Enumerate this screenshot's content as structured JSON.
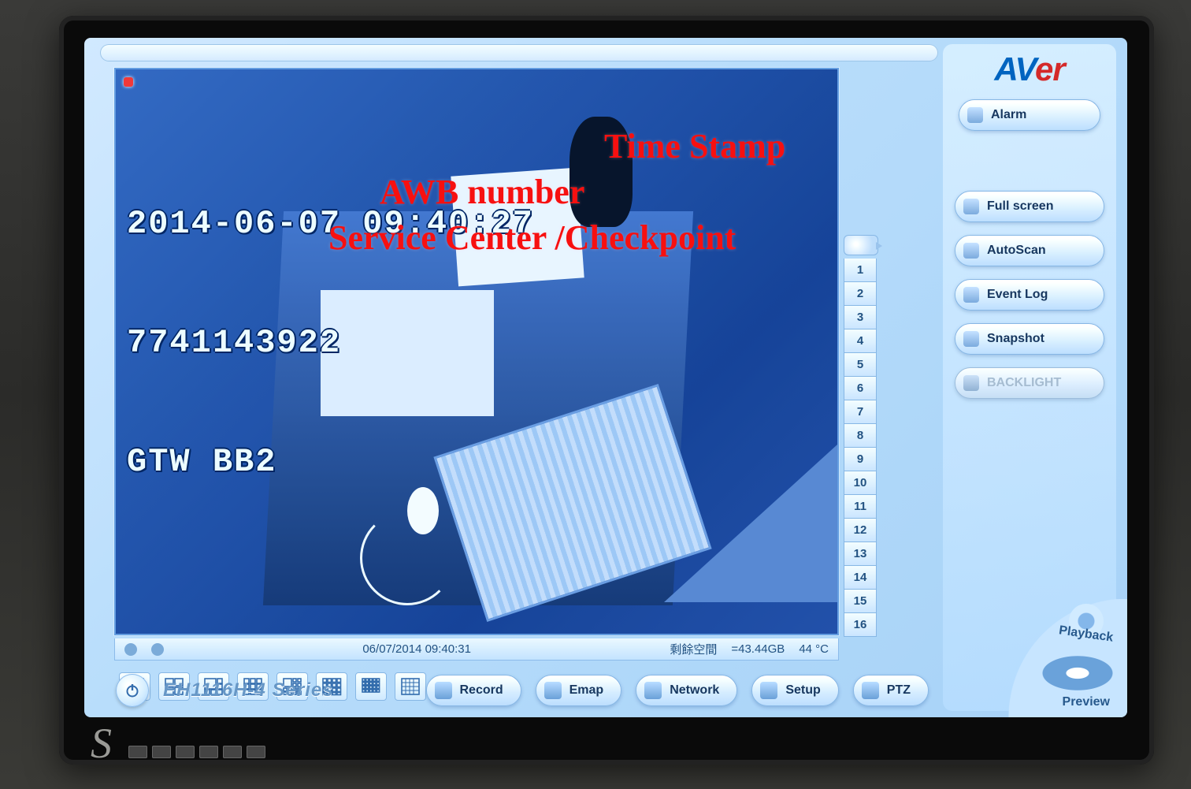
{
  "brand": {
    "logo_a": "AV",
    "logo_b": "er"
  },
  "video_osd": {
    "timestamp": "2014-06-07 09:40:27",
    "awb": "7741143922",
    "checkpoint": "GTW BB2"
  },
  "annotations": {
    "timestamp": "Time Stamp",
    "awb": "AWB number",
    "checkpoint": "Service Center /Checkpoint"
  },
  "statusbar": {
    "datetime": "06/07/2014 09:40:31",
    "disk_label": "剩餘空間",
    "disk_value": "=43.44GB",
    "temp": "44 °C"
  },
  "channels": [
    "1",
    "2",
    "3",
    "4",
    "5",
    "6",
    "7",
    "8",
    "9",
    "10",
    "11",
    "12",
    "13",
    "14",
    "15",
    "16"
  ],
  "sidebar": {
    "alarm": "Alarm",
    "fullscreen": "Full screen",
    "autoscan": "AutoScan",
    "eventlog": "Event Log",
    "snapshot": "Snapshot",
    "backlight": "BACKLIGHT"
  },
  "cmdbar": {
    "model": "EH1116H-4 Series",
    "record": "Record",
    "emap": "Emap",
    "network": "Network",
    "setup": "Setup",
    "ptz": "PTZ"
  },
  "wedge": {
    "playback": "Playback",
    "preview": "Preview"
  }
}
